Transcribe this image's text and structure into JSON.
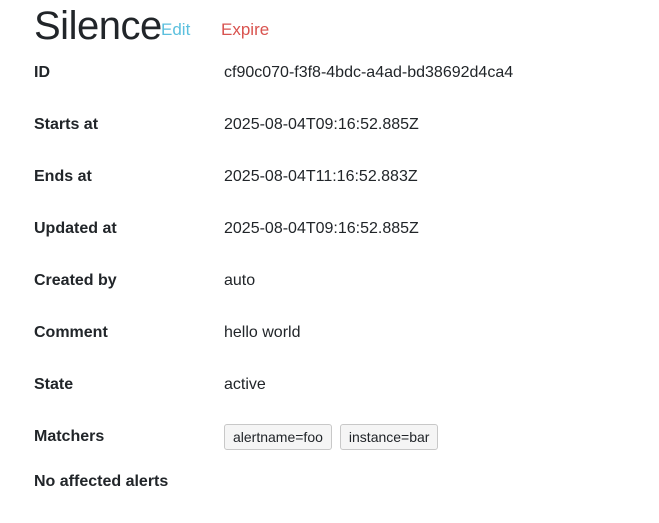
{
  "header": {
    "title": "Silence",
    "edit_label": "Edit",
    "expire_label": "Expire"
  },
  "details": [
    {
      "label": "ID",
      "value": "cf90c070-f3f8-4bdc-a4ad-bd38692d4ca4"
    },
    {
      "label": "Starts at",
      "value": "2025-08-04T09:16:52.885Z"
    },
    {
      "label": "Ends at",
      "value": "2025-08-04T11:16:52.883Z"
    },
    {
      "label": "Updated at",
      "value": "2025-08-04T09:16:52.885Z"
    },
    {
      "label": "Created by",
      "value": "auto"
    },
    {
      "label": "Comment",
      "value": "hello world"
    },
    {
      "label": "State",
      "value": "active"
    }
  ],
  "matchers": {
    "label": "Matchers",
    "items": [
      "alertname=foo",
      "instance=bar"
    ]
  },
  "affected_alerts_text": "No affected alerts",
  "colors": {
    "edit": "#5bc0de",
    "expire": "#d9534f"
  }
}
